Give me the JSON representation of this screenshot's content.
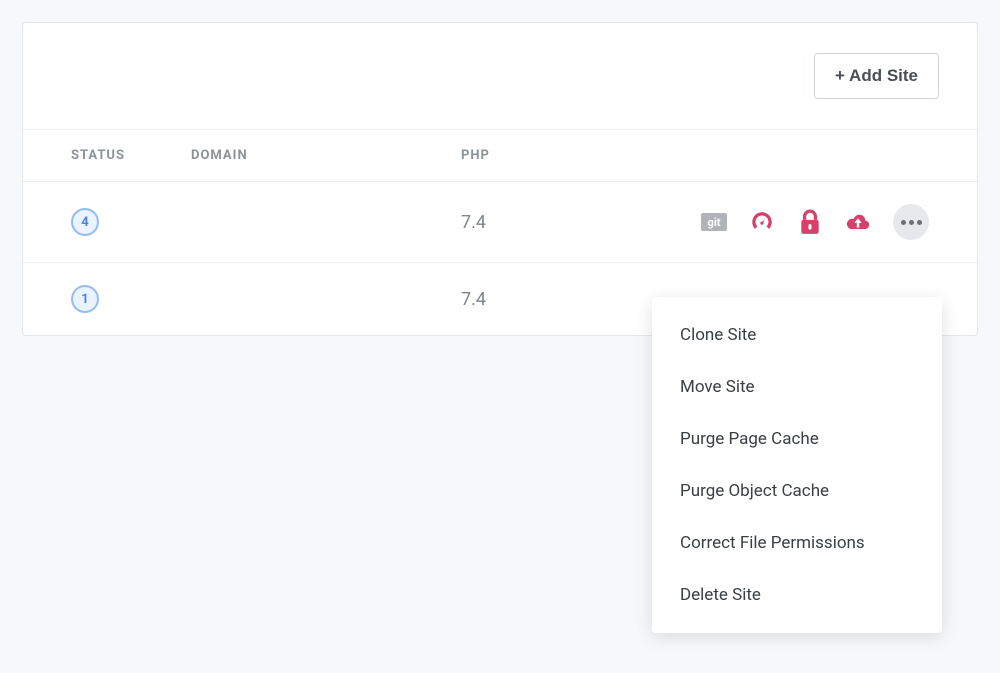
{
  "header": {
    "add_site_label": "+ Add Site"
  },
  "columns": {
    "status": "STATUS",
    "domain": "DOMAIN",
    "php": "PHP"
  },
  "rows": [
    {
      "status_count": "4",
      "domain": "",
      "php": "7.4"
    },
    {
      "status_count": "1",
      "domain": "",
      "php": "7.4"
    }
  ],
  "action_icons": {
    "git": "git",
    "speed": "speed",
    "lock": "lock",
    "upload": "upload",
    "more": "more"
  },
  "colors": {
    "accent": "#d6406b",
    "muted": "#b0b3b8"
  },
  "dropdown": {
    "items": [
      "Clone Site",
      "Move Site",
      "Purge Page Cache",
      "Purge Object Cache",
      "Correct File Permissions",
      "Delete Site"
    ]
  }
}
